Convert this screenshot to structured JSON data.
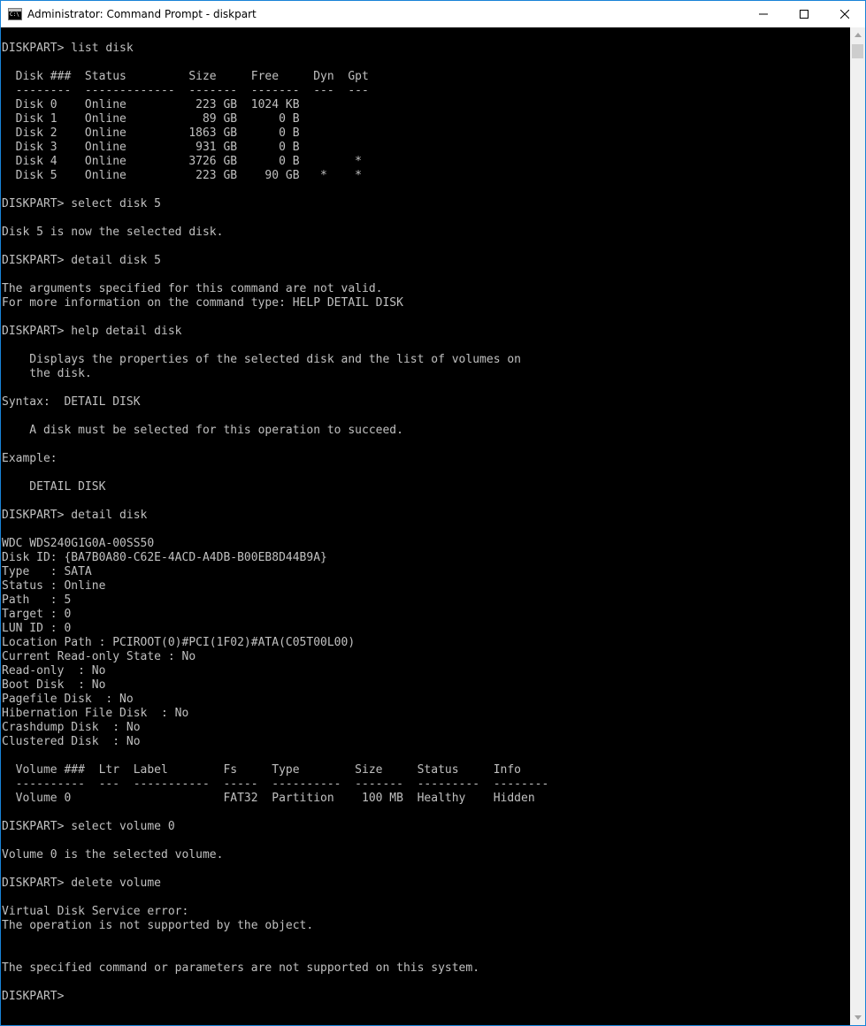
{
  "window": {
    "title": "Administrator: Command Prompt - diskpart",
    "icon": "cmd-icon"
  },
  "title_buttons": {
    "minimize": "minimize-icon",
    "maximize": "maximize-icon",
    "close": "close-icon"
  },
  "console": {
    "lines": [
      "DISKPART> list disk",
      "",
      "  Disk ###  Status         Size     Free     Dyn  Gpt",
      "  --------  -------------  -------  -------  ---  ---",
      "  Disk 0    Online          223 GB  1024 KB",
      "  Disk 1    Online           89 GB      0 B",
      "  Disk 2    Online         1863 GB      0 B",
      "  Disk 3    Online          931 GB      0 B",
      "  Disk 4    Online         3726 GB      0 B        *",
      "  Disk 5    Online          223 GB    90 GB   *    *",
      "",
      "DISKPART> select disk 5",
      "",
      "Disk 5 is now the selected disk.",
      "",
      "DISKPART> detail disk 5",
      "",
      "The arguments specified for this command are not valid.",
      "For more information on the command type: HELP DETAIL DISK",
      "",
      "DISKPART> help detail disk",
      "",
      "    Displays the properties of the selected disk and the list of volumes on",
      "    the disk.",
      "",
      "Syntax:  DETAIL DISK",
      "",
      "    A disk must be selected for this operation to succeed.",
      "",
      "Example:",
      "",
      "    DETAIL DISK",
      "",
      "DISKPART> detail disk",
      "",
      "WDC WDS240G1G0A-00SS50",
      "Disk ID: {BA7B0A80-C62E-4ACD-A4DB-B00EB8D44B9A}",
      "Type   : SATA",
      "Status : Online",
      "Path   : 5",
      "Target : 0",
      "LUN ID : 0",
      "Location Path : PCIROOT(0)#PCI(1F02)#ATA(C05T00L00)",
      "Current Read-only State : No",
      "Read-only  : No",
      "Boot Disk  : No",
      "Pagefile Disk  : No",
      "Hibernation File Disk  : No",
      "Crashdump Disk  : No",
      "Clustered Disk  : No",
      "",
      "  Volume ###  Ltr  Label        Fs     Type        Size     Status     Info",
      "  ----------  ---  -----------  -----  ----------  -------  ---------  --------",
      "  Volume 0                      FAT32  Partition    100 MB  Healthy    Hidden",
      "",
      "DISKPART> select volume 0",
      "",
      "Volume 0 is the selected volume.",
      "",
      "DISKPART> delete volume",
      "",
      "Virtual Disk Service error:",
      "The operation is not supported by the object.",
      "",
      "",
      "The specified command or parameters are not supported on this system.",
      "",
      "DISKPART> "
    ]
  },
  "scrollbar": {
    "up": "scroll-up-arrow-icon",
    "down": "scroll-down-arrow-icon"
  }
}
